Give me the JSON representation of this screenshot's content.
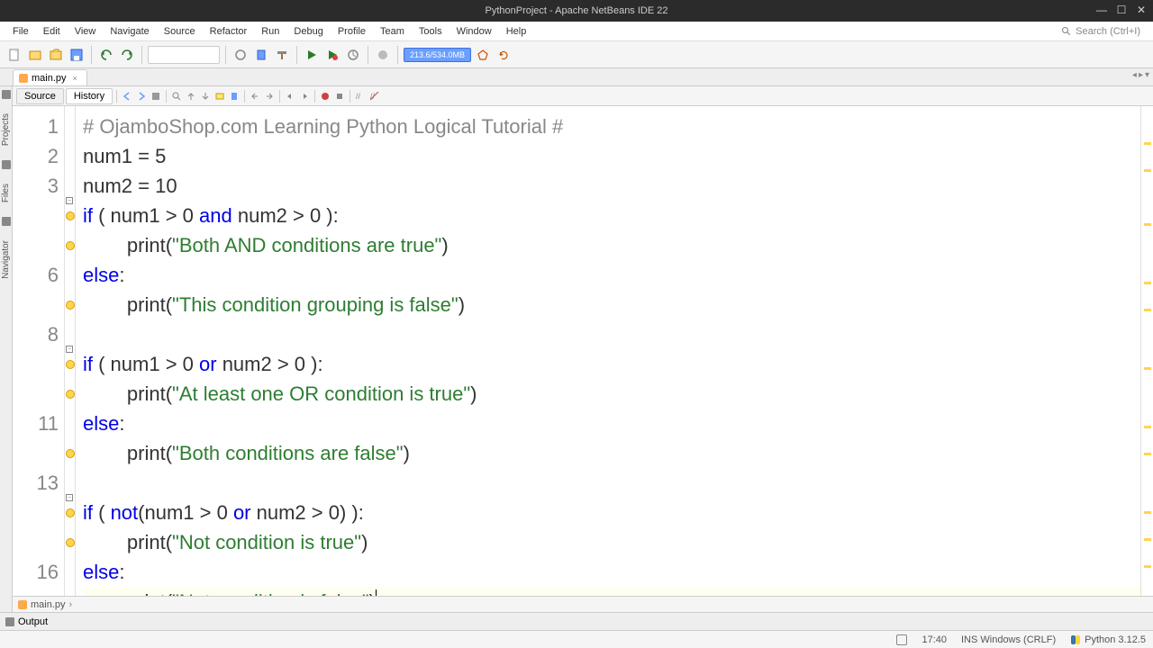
{
  "window": {
    "title": "PythonProject - Apache NetBeans IDE 22"
  },
  "menu": {
    "items": [
      "File",
      "Edit",
      "View",
      "Navigate",
      "Source",
      "Refactor",
      "Run",
      "Debug",
      "Profile",
      "Team",
      "Tools",
      "Window",
      "Help"
    ],
    "search_placeholder": "Search (Ctrl+I)"
  },
  "toolbar": {
    "memory": "213.6/534.0MB"
  },
  "tab": {
    "filename": "main.py"
  },
  "srcbar": {
    "source": "Source",
    "history": "History"
  },
  "code": {
    "lines": [
      {
        "n": "1",
        "cls": "cmt",
        "html": "<span class='cmt'># OjamboShop.com Learning Python Logical Tutorial #</span>"
      },
      {
        "n": "2",
        "cls": "",
        "html": "num1 = 5"
      },
      {
        "n": "3",
        "cls": "",
        "html": "num2 = 10"
      },
      {
        "n": "",
        "cls": "bulb",
        "html": "<span class='kw'>if</span> ( num1 &gt; 0 <span class='kw'>and</span> num2 &gt; 0 ):"
      },
      {
        "n": "",
        "cls": "bulb",
        "html": "        print(<span class='str'>\"Both AND conditions are true\"</span>)"
      },
      {
        "n": "6",
        "cls": "",
        "html": "<span class='kw'>else</span>:"
      },
      {
        "n": "",
        "cls": "bulb",
        "html": "        print(<span class='str'>\"This condition grouping is false\"</span>)"
      },
      {
        "n": "8",
        "cls": "",
        "html": ""
      },
      {
        "n": "",
        "cls": "bulb",
        "html": "<span class='kw'>if</span> ( num1 &gt; 0 <span class='kw'>or</span> num2 &gt; 0 ):"
      },
      {
        "n": "",
        "cls": "bulb",
        "html": "        print(<span class='str'>\"At least one OR condition is true\"</span>)"
      },
      {
        "n": "11",
        "cls": "",
        "html": "<span class='kw'>else</span>:"
      },
      {
        "n": "",
        "cls": "bulb",
        "html": "        print(<span class='str'>\"Both conditions are false\"</span>)"
      },
      {
        "n": "13",
        "cls": "",
        "html": ""
      },
      {
        "n": "",
        "cls": "bulb",
        "html": "<span class='kw'>if</span> ( <span class='kw'>not</span>(num1 &gt; 0 <span class='kw'>or</span> num2 &gt; 0) ):"
      },
      {
        "n": "",
        "cls": "bulb",
        "html": "        print(<span class='str'>\"Not condition is true\"</span>)"
      },
      {
        "n": "16",
        "cls": "",
        "html": "<span class='kw'>else</span>:"
      },
      {
        "n": "",
        "cls": "bulb hl",
        "html": "        print(<span class='str'>\"Not condition is false\"</span>)<span class='caret'></span>"
      }
    ]
  },
  "breadcrumb": {
    "file": "main.py"
  },
  "output": {
    "label": "Output"
  },
  "status": {
    "cursor": "17:40",
    "encoding": "INS Windows (CRLF)",
    "python": "Python 3.12.5"
  }
}
